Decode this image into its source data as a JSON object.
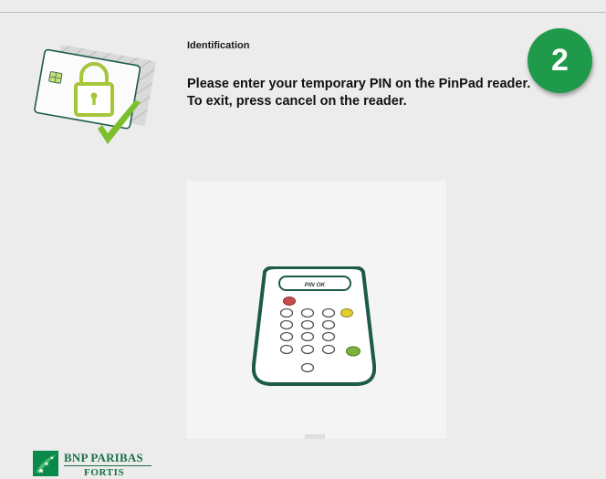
{
  "header": {
    "title": "Identification",
    "instruction_line1": "Please enter your temporary PIN on the PinPad reader.",
    "instruction_line2": "To exit, press cancel on the reader."
  },
  "step_badge": {
    "number": "2",
    "color": "#1f9a4a"
  },
  "illustration": {
    "card_icon": "card-with-lock-icon",
    "check_icon": "checkmark-icon"
  },
  "pinpad": {
    "screen_text": "PIN OK",
    "icon": "pinpad-reader-icon",
    "accent_color": "#1c5a4a"
  },
  "brand": {
    "name_line1": "BNP PARIBAS",
    "name_line2": "FORTIS",
    "color": "#1b6f46"
  }
}
